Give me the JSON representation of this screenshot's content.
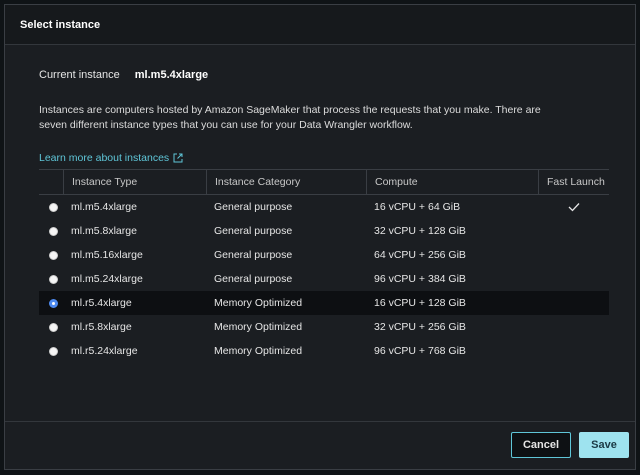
{
  "dialog": {
    "title": "Select instance",
    "current_label": "Current instance",
    "current_value": "ml.m5.4xlarge",
    "description": "Instances are computers hosted by Amazon SageMaker that process the requests that you make. There are seven different instance types that you can use for your Data Wrangler workflow.",
    "learn_more": "Learn more about instances"
  },
  "table": {
    "headers": [
      "Instance Type",
      "Instance Category",
      "Compute",
      "Fast Launch"
    ],
    "rows": [
      {
        "type": "ml.m5.4xlarge",
        "category": "General purpose",
        "compute": "16 vCPU + 64 GiB",
        "fast_launch": "✓",
        "selected": false
      },
      {
        "type": "ml.m5.8xlarge",
        "category": "General purpose",
        "compute": "32 vCPU + 128 GiB",
        "fast_launch": "",
        "selected": false
      },
      {
        "type": "ml.m5.16xlarge",
        "category": "General purpose",
        "compute": "64 vCPU + 256 GiB",
        "fast_launch": "",
        "selected": false
      },
      {
        "type": "ml.m5.24xlarge",
        "category": "General purpose",
        "compute": "96 vCPU + 384 GiB",
        "fast_launch": "",
        "selected": false
      },
      {
        "type": "ml.r5.4xlarge",
        "category": "Memory Optimized",
        "compute": "16 vCPU + 128 GiB",
        "fast_launch": "",
        "selected": true
      },
      {
        "type": "ml.r5.8xlarge",
        "category": "Memory Optimized",
        "compute": "32 vCPU + 256 GiB",
        "fast_launch": "",
        "selected": false
      },
      {
        "type": "ml.r5.24xlarge",
        "category": "Memory Optimized",
        "compute": "96 vCPU + 768 GiB",
        "fast_launch": "",
        "selected": false
      }
    ]
  },
  "footer": {
    "cancel_label": "Cancel",
    "save_label": "Save"
  },
  "icons": {
    "external_link": "external-link-icon",
    "check": "check-icon"
  },
  "colors": {
    "link": "#5fc6d8",
    "primary": "#9ee3ef",
    "radio_selected": "#4d8af0"
  }
}
